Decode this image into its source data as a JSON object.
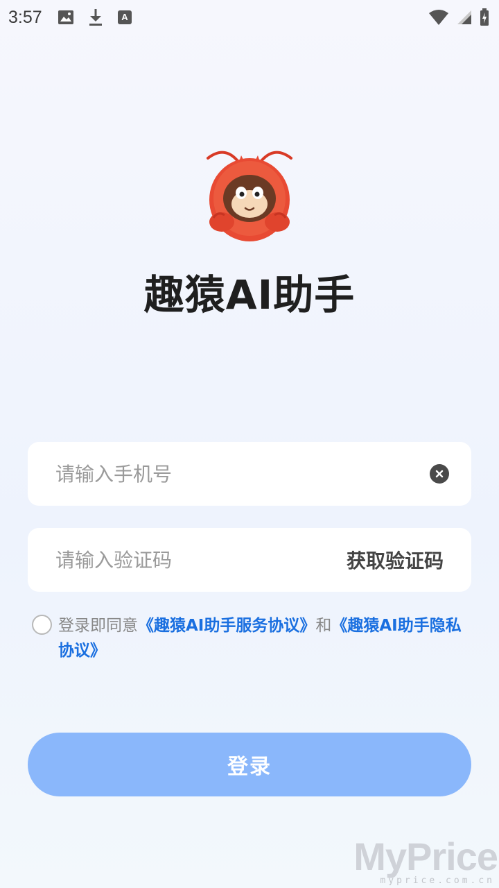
{
  "status_bar": {
    "time": "3:57",
    "left_icons": [
      "image-icon",
      "download-icon",
      "font-icon"
    ],
    "right_icons": [
      "wifi-icon",
      "signal-icon",
      "battery-charging-icon"
    ]
  },
  "app": {
    "title": "趣猿AI助手",
    "logo": "monkey-lobster-mascot"
  },
  "form": {
    "phone_placeholder": "请输入手机号",
    "phone_value": "",
    "code_placeholder": "请输入验证码",
    "code_value": "",
    "get_code_label": "获取验证码",
    "clear_icon": "clear-icon"
  },
  "agreement": {
    "prefix": "登录即同意",
    "service_link": "《趣猿AI助手服务协议》",
    "conjunction": "和",
    "privacy_link": "《趣猿AI助手隐私协议》",
    "checked": false
  },
  "login": {
    "label": "登录"
  },
  "watermark": {
    "main": "MyPrice",
    "sub": "myprice.com.cn"
  },
  "colors": {
    "accent_link": "#1a6fe0",
    "login_button": "#8ab7fb",
    "mascot_red": "#e84a33",
    "mascot_brown": "#6b3a24"
  }
}
